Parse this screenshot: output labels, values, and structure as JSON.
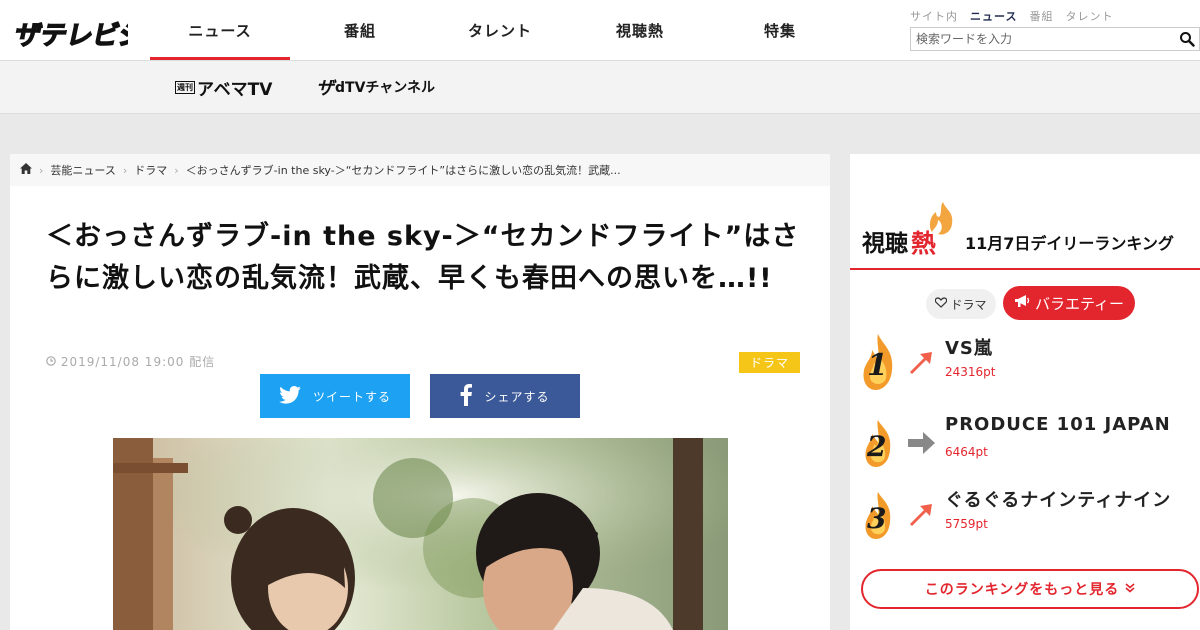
{
  "header": {
    "logo_text": "ザテレビジョン",
    "nav": [
      {
        "label": "ニュース",
        "active": true
      },
      {
        "label": "番組",
        "active": false
      },
      {
        "label": "タレント",
        "active": false
      },
      {
        "label": "視聴熱",
        "active": false
      },
      {
        "label": "特集",
        "active": false
      }
    ],
    "search_tabs": [
      {
        "label": "サイト内",
        "active": false
      },
      {
        "label": "ニュース",
        "active": true
      },
      {
        "label": "番組",
        "active": false
      },
      {
        "label": "タレント",
        "active": false
      }
    ],
    "search_placeholder": "検索ワードを入力"
  },
  "subnav": {
    "abema_badge": "週刊",
    "abema_label": "アベマTV",
    "dtv_prefix": "ザ",
    "dtv_label": "dTVチャンネル"
  },
  "breadcrumb": [
    "芸能ニュース",
    "ドラマ",
    "＜おっさんずラブ-in the sky-＞“セカンドフライト”はさらに激しい恋の乱気流！武蔵..."
  ],
  "article": {
    "title": "＜おっさんずラブ-in the sky-＞“セカンドフライト”はさらに激しい恋の乱気流！武蔵、早くも春田への思いを…!!",
    "date": "2019/11/08 19:00",
    "date_suffix": "配信",
    "category": "ドラマ",
    "tweet_label": "ツイートする",
    "share_label": "シェアする"
  },
  "sidebar": {
    "heading_a": "視聴",
    "heading_b": "熱",
    "heading_date": "11月7日デイリーランキング",
    "tab_drama": "ドラマ",
    "tab_variety": "バラエティー",
    "ranking": [
      {
        "rank": "1",
        "title": "VS嵐",
        "points": "24316pt",
        "trend": "up"
      },
      {
        "rank": "2",
        "title": "PRODUCE 101 JAPAN",
        "points": "6464pt",
        "trend": "flat"
      },
      {
        "rank": "3",
        "title": "ぐるぐるナインティナイン",
        "points": "5759pt",
        "trend": "up"
      }
    ],
    "more_label": "このランキングをもっと見る"
  },
  "colors": {
    "accent": "#e3262e",
    "twitter": "#1da1f2",
    "facebook": "#3b5998",
    "category": "#f5c518"
  }
}
